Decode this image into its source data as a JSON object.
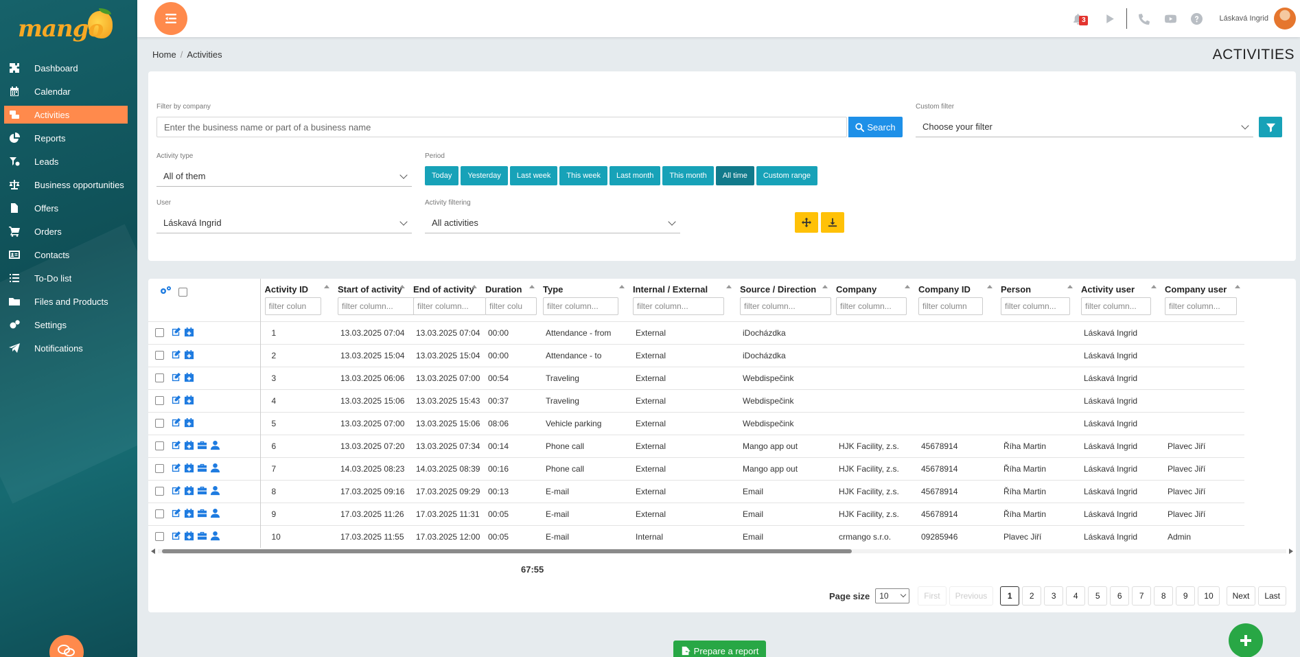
{
  "app": {
    "logo_text": "mango"
  },
  "sidebar": {
    "items": [
      {
        "label": "Dashboard",
        "icon": "puzzle-icon"
      },
      {
        "label": "Calendar",
        "icon": "calendar-icon"
      },
      {
        "label": "Activities",
        "icon": "activities-icon",
        "active": true
      },
      {
        "label": "Reports",
        "icon": "pie-chart-icon"
      },
      {
        "label": "Leads",
        "icon": "funnel-icon"
      },
      {
        "label": "Business opportunities",
        "icon": "scale-icon"
      },
      {
        "label": "Offers",
        "icon": "document-icon"
      },
      {
        "label": "Orders",
        "icon": "cart-icon"
      },
      {
        "label": "Contacts",
        "icon": "address-card-icon"
      },
      {
        "label": "To-Do list",
        "icon": "list-icon"
      },
      {
        "label": "Files and Products",
        "icon": "folder-icon"
      },
      {
        "label": "Settings",
        "icon": "gears-icon"
      },
      {
        "label": "Notifications",
        "icon": "paper-plane-icon"
      }
    ]
  },
  "topbar": {
    "notification_count": "3",
    "username": "Láskavá Ingrid"
  },
  "breadcrumb": {
    "home": "Home",
    "current": "Activities"
  },
  "page_title": "ACTIVITIES",
  "filters": {
    "company_label": "Filter by company",
    "company_placeholder": "Enter the business name or part of a business name",
    "search_label": "Search",
    "custom_filter_label": "Custom filter",
    "custom_filter_value": "Choose your filter",
    "activity_type_label": "Activity type",
    "activity_type_value": "All of them",
    "period_label": "Period",
    "period_buttons": [
      "Today",
      "Yesterday",
      "Last week",
      "This week",
      "Last month",
      "This month",
      "All time",
      "Custom range"
    ],
    "period_active": "All time",
    "user_label": "User",
    "user_value": "Láskavá Ingrid",
    "activity_filtering_label": "Activity filtering",
    "activity_filtering_value": "All activities"
  },
  "table": {
    "columns": [
      {
        "name": "Activity ID",
        "placeholder": "filter colun"
      },
      {
        "name": "Start of activity",
        "placeholder": "filter column..."
      },
      {
        "name": "End of activity",
        "placeholder": "filter column..."
      },
      {
        "name": "Duration",
        "placeholder": "filter colu"
      },
      {
        "name": "Type",
        "placeholder": "filter column..."
      },
      {
        "name": "Internal / External",
        "placeholder": "filter column..."
      },
      {
        "name": "Source / Direction",
        "placeholder": "filter column..."
      },
      {
        "name": "Company",
        "placeholder": "filter column..."
      },
      {
        "name": "Company ID",
        "placeholder": "filter column"
      },
      {
        "name": "Person",
        "placeholder": "filter column..."
      },
      {
        "name": "Activity user",
        "placeholder": "filter column..."
      },
      {
        "name": "Company user",
        "placeholder": "filter column..."
      }
    ],
    "rows": [
      {
        "actions": 2,
        "cells": [
          "1",
          "13.03.2025 07:04",
          "13.03.2025 07:04",
          "00:00",
          "Attendance - from",
          "External",
          "iDocházdka",
          "",
          "",
          "",
          "Láskavá Ingrid",
          ""
        ]
      },
      {
        "actions": 2,
        "cells": [
          "2",
          "13.03.2025 15:04",
          "13.03.2025 15:04",
          "00:00",
          "Attendance - to",
          "External",
          "iDocházdka",
          "",
          "",
          "",
          "Láskavá Ingrid",
          ""
        ]
      },
      {
        "actions": 2,
        "cells": [
          "3",
          "13.03.2025 06:06",
          "13.03.2025 07:00",
          "00:54",
          "Traveling",
          "External",
          "Webdispečink",
          "",
          "",
          "",
          "Láskavá Ingrid",
          ""
        ]
      },
      {
        "actions": 2,
        "cells": [
          "4",
          "13.03.2025 15:06",
          "13.03.2025 15:43",
          "00:37",
          "Traveling",
          "External",
          "Webdispečink",
          "",
          "",
          "",
          "Láskavá Ingrid",
          ""
        ]
      },
      {
        "actions": 2,
        "cells": [
          "5",
          "13.03.2025 07:00",
          "13.03.2025 15:06",
          "08:06",
          "Vehicle parking",
          "External",
          "Webdispečink",
          "",
          "",
          "",
          "Láskavá Ingrid",
          ""
        ]
      },
      {
        "actions": 4,
        "cells": [
          "6",
          "13.03.2025 07:20",
          "13.03.2025 07:34",
          "00:14",
          "Phone call",
          "External",
          "Mango app out",
          "HJK Facility, z.s.",
          "45678914",
          "Říha Martin",
          "Láskavá Ingrid",
          "Plavec Jiří"
        ]
      },
      {
        "actions": 4,
        "cells": [
          "7",
          "14.03.2025 08:23",
          "14.03.2025 08:39",
          "00:16",
          "Phone call",
          "External",
          "Mango app out",
          "HJK Facility, z.s.",
          "45678914",
          "Říha Martin",
          "Láskavá Ingrid",
          "Plavec Jiří"
        ]
      },
      {
        "actions": 4,
        "cells": [
          "8",
          "17.03.2025 09:16",
          "17.03.2025 09:29",
          "00:13",
          "E-mail",
          "External",
          "Email",
          "HJK Facility, z.s.",
          "45678914",
          "Říha Martin",
          "Láskavá Ingrid",
          "Plavec Jiří"
        ]
      },
      {
        "actions": 4,
        "cells": [
          "9",
          "17.03.2025 11:26",
          "17.03.2025 11:31",
          "00:05",
          "E-mail",
          "External",
          "Email",
          "HJK Facility, z.s.",
          "45678914",
          "Říha Martin",
          "Láskavá Ingrid",
          "Plavec Jiří"
        ]
      },
      {
        "actions": 4,
        "cells": [
          "10",
          "17.03.2025 11:55",
          "17.03.2025 12:00",
          "00:05",
          "E-mail",
          "Internal",
          "Email",
          "crmango s.r.o.",
          "09285946",
          "Plavec Jiří",
          "Láskavá Ingrid",
          "Admin"
        ]
      }
    ],
    "duration_total": "67:55"
  },
  "pagination": {
    "page_size_label": "Page size",
    "page_size_value": "10",
    "first": "First",
    "previous": "Previous",
    "pages": [
      "1",
      "2",
      "3",
      "4",
      "5",
      "6",
      "7",
      "8",
      "9",
      "10"
    ],
    "current_page": "1",
    "next": "Next",
    "last": "Last"
  },
  "footer": {
    "report_button": "Prepare a report"
  },
  "colors": {
    "accent_orange": "#ff8a4c",
    "teal": "#17a2b8",
    "blue": "#1e90e8",
    "green": "#28a745",
    "yellow": "#ffc107"
  }
}
